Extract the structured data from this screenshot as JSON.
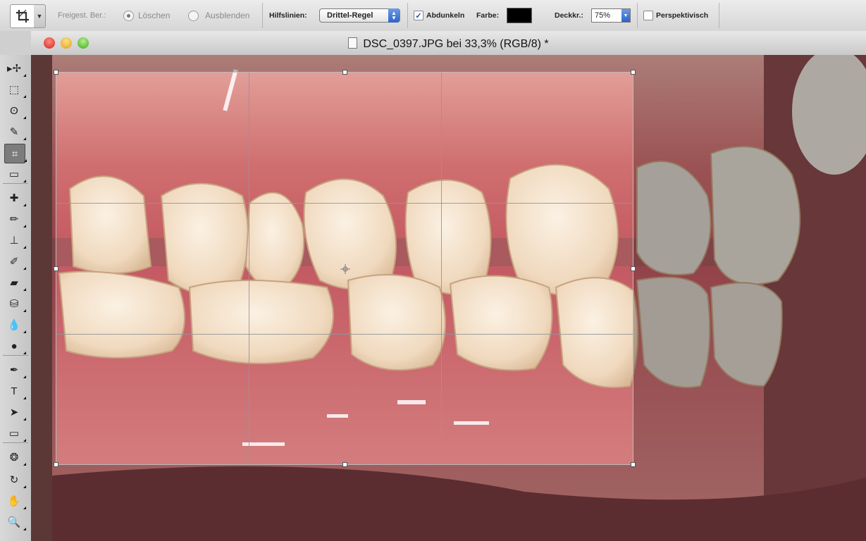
{
  "options_bar": {
    "crop_area_label": "Freigest. Ber.:",
    "radio_delete": "Löschen",
    "radio_hide": "Ausblenden",
    "guides_label": "Hilfslinien:",
    "guides_value": "Drittel-Regel",
    "darken_label": "Abdunkeln",
    "color_label": "Farbe:",
    "color_value": "#000000",
    "opacity_label": "Deckkr.:",
    "opacity_value": "75%",
    "perspective_label": "Perspektivisch",
    "darken_checked": true,
    "perspective_checked": false,
    "selected_radio": "delete"
  },
  "document": {
    "title": "DSC_0397.JPG bei 33,3% (RGB/8) *"
  },
  "toolbox": {
    "tools": [
      {
        "name": "move-tool",
        "glyph": "▸✢"
      },
      {
        "name": "marquee-tool",
        "glyph": "⬚"
      },
      {
        "name": "lasso-tool",
        "glyph": "ʘ"
      },
      {
        "name": "quick-selection-tool",
        "glyph": "✎"
      },
      {
        "name": "crop-tool",
        "glyph": "⌗"
      },
      {
        "name": "ruler-tool",
        "glyph": "▭"
      },
      {
        "name": "healing-brush-tool",
        "glyph": "✚"
      },
      {
        "name": "brush-tool",
        "glyph": "✏"
      },
      {
        "name": "clone-stamp-tool",
        "glyph": "⊥"
      },
      {
        "name": "history-brush-tool",
        "glyph": "✐"
      },
      {
        "name": "eraser-tool",
        "glyph": "▰"
      },
      {
        "name": "paint-bucket-tool",
        "glyph": "⛁"
      },
      {
        "name": "blur-tool",
        "glyph": "💧"
      },
      {
        "name": "dodge-tool",
        "glyph": "●"
      },
      {
        "name": "pen-tool",
        "glyph": "✒"
      },
      {
        "name": "type-tool",
        "glyph": "T"
      },
      {
        "name": "path-selection-tool",
        "glyph": "➤"
      },
      {
        "name": "rectangle-tool",
        "glyph": "▭"
      },
      {
        "name": "3d-rotate-tool",
        "glyph": "❂"
      },
      {
        "name": "3d-orbit-tool",
        "glyph": "↻"
      },
      {
        "name": "hand-tool",
        "glyph": "✋"
      },
      {
        "name": "zoom-tool",
        "glyph": "🔍"
      }
    ]
  },
  "colors": {
    "active_accent": "#2f63c6",
    "gum": "#c8606a",
    "tooth": "#efd9bc"
  }
}
